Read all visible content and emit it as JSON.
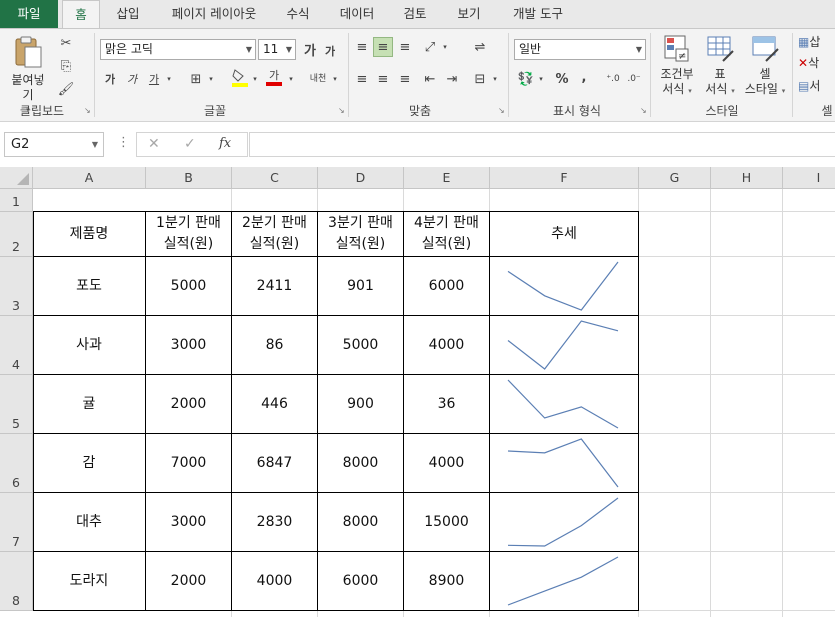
{
  "tabs": [
    "파일",
    "홈",
    "삽입",
    "페이지 레이아웃",
    "수식",
    "데이터",
    "검토",
    "보기",
    "개발 도구"
  ],
  "active_tab": "홈",
  "ribbon": {
    "clipboard": {
      "paste_label": "붙여넣기",
      "group_label": "클립보드"
    },
    "font": {
      "font_name": "맑은 고딕",
      "font_size": "11",
      "grow_label": "가",
      "shrink_label": "가",
      "bold_label": "가",
      "italic_label": "가",
      "underline_label": "가",
      "font_color_label": "가",
      "phonetic_label": "내천",
      "group_label": "글꼴"
    },
    "alignment": {
      "group_label": "맞춤"
    },
    "number": {
      "format_value": "일반",
      "percent": "%",
      "comma": ",",
      "group_label": "표시 형식"
    },
    "styles": {
      "conditional_line1": "조건부",
      "conditional_line2": "서식",
      "table_line1": "표",
      "table_line2": "서식",
      "cell_line1": "셀",
      "cell_line2": "스타일",
      "group_label": "스타일"
    },
    "cells": {
      "insert_label": "삽",
      "delete_label": "삭",
      "format_label": "서",
      "group_label": "셀"
    }
  },
  "formula_bar": {
    "name_box": "G2",
    "fx": "fx",
    "formula": ""
  },
  "columns": [
    "A",
    "B",
    "C",
    "D",
    "E",
    "F",
    "G",
    "H",
    "I"
  ],
  "rows": [
    "1",
    "2",
    "3",
    "4",
    "5",
    "6",
    "7",
    "8"
  ],
  "table": {
    "headers": [
      "제품명",
      "1분기 판매 실적(원)",
      "2분기 판매 실적(원)",
      "3분기 판매 실적(원)",
      "4분기 판매 실적(원)",
      "추세"
    ],
    "header_lines": [
      [
        "제품명"
      ],
      [
        "1분기 판매",
        "실적(원)"
      ],
      [
        "2분기 판매",
        "실적(원)"
      ],
      [
        "3분기 판매",
        "실적(원)"
      ],
      [
        "4분기 판매",
        "실적(원)"
      ],
      [
        "추세"
      ]
    ],
    "rows": [
      {
        "name": "포도",
        "values": [
          5000,
          2411,
          901,
          6000
        ]
      },
      {
        "name": "사과",
        "values": [
          3000,
          86,
          5000,
          4000
        ]
      },
      {
        "name": "귤",
        "values": [
          2000,
          446,
          900,
          36
        ]
      },
      {
        "name": "감",
        "values": [
          7000,
          6847,
          8000,
          4000
        ]
      },
      {
        "name": "대추",
        "values": [
          3000,
          2830,
          8000,
          15000
        ]
      },
      {
        "name": "도라지",
        "values": [
          2000,
          4000,
          6000,
          8900
        ]
      }
    ]
  },
  "sparkline_color": "#5b7fb4",
  "accent_color": "#217346"
}
